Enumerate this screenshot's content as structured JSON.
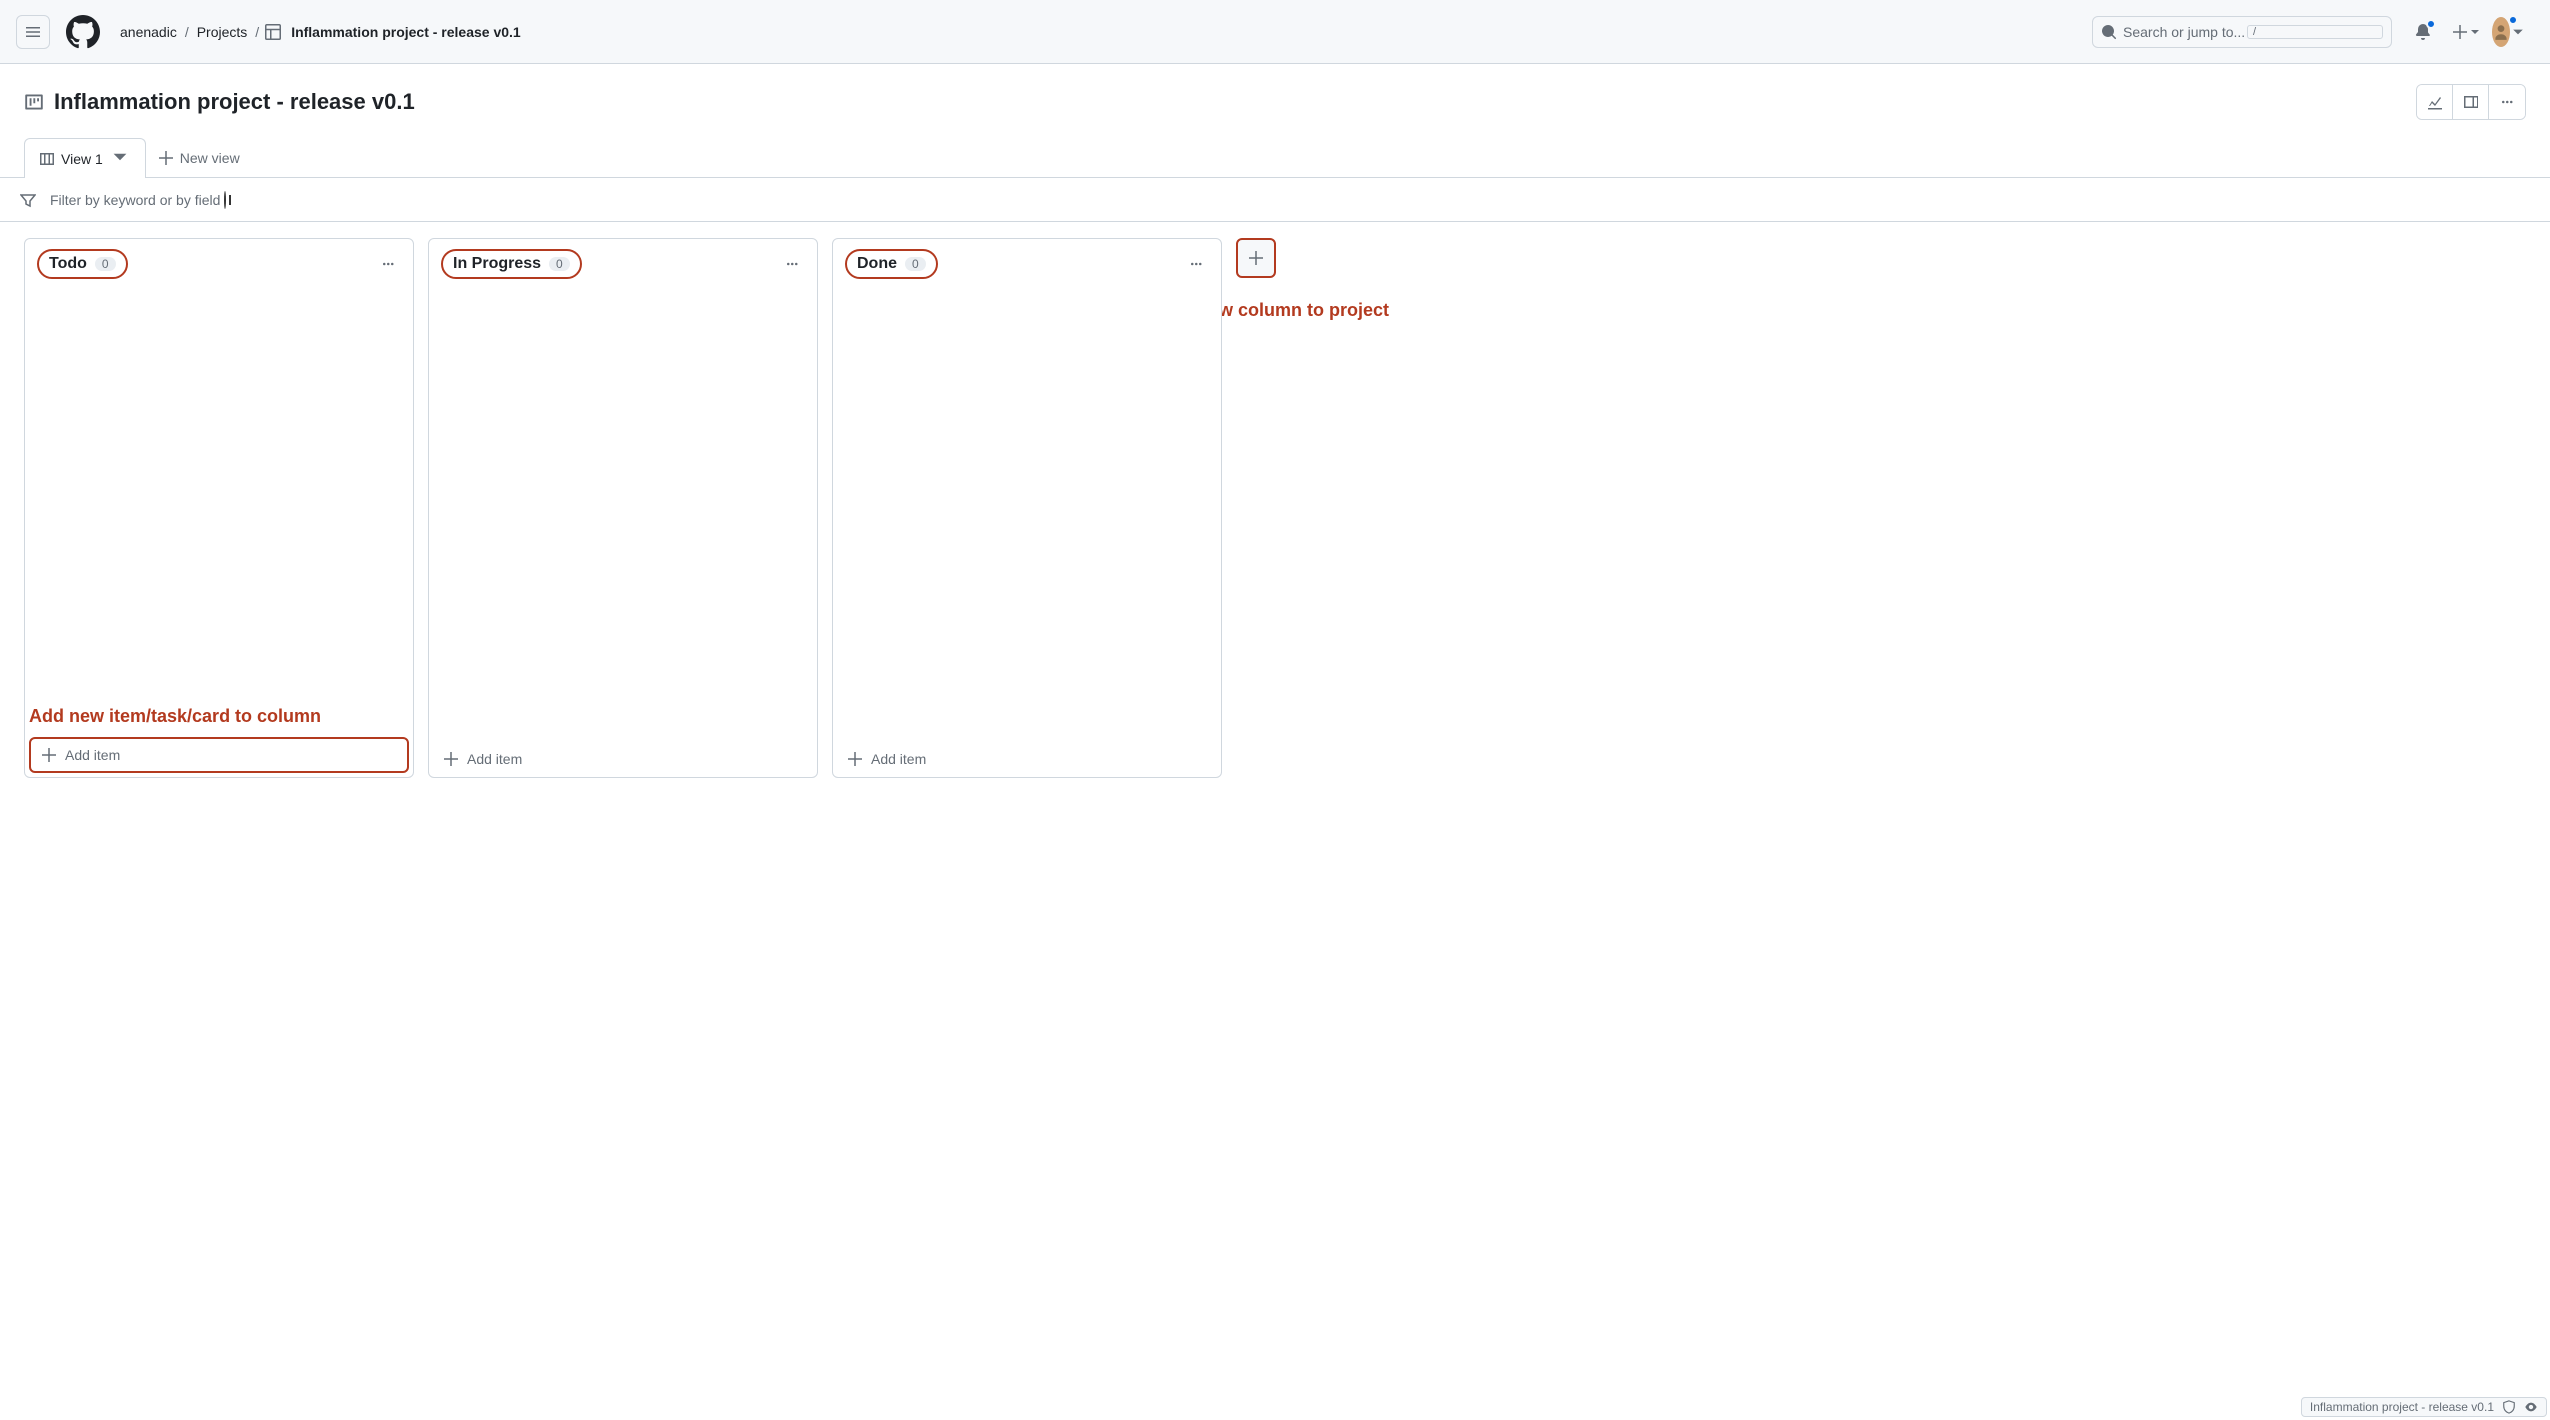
{
  "header": {
    "breadcrumb_user": "anenadic",
    "breadcrumb_section": "Projects",
    "breadcrumb_current": "Inflammation project - release v0.1",
    "search_placeholder": "Search or jump to...",
    "search_kbd": "/"
  },
  "project": {
    "title": "Inflammation project - release v0.1"
  },
  "tabs": {
    "view_label": "View 1",
    "new_view_label": "New view"
  },
  "filter": {
    "placeholder": "Filter by keyword or by field"
  },
  "columns": [
    {
      "name": "Todo",
      "count": "0",
      "add_label": "Add item"
    },
    {
      "name": "In Progress",
      "count": "0",
      "add_label": "Add item"
    },
    {
      "name": "Done",
      "count": "0",
      "add_label": "Add item"
    }
  ],
  "annotations": {
    "new_item": "Add new item/task/card to column",
    "new_column": "Add new column to project"
  },
  "status_bar": {
    "text": "Inflammation project - release v0.1"
  }
}
